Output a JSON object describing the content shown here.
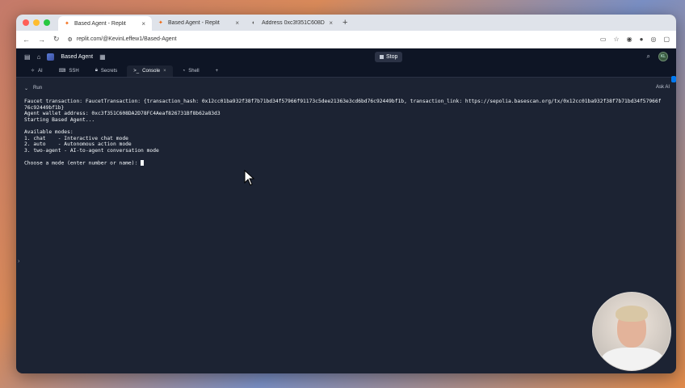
{
  "browser": {
    "tabs": [
      {
        "label": "Based Agent - Replit",
        "active": true
      },
      {
        "label": "Based Agent - Replit",
        "active": false
      },
      {
        "label": "Address 0xc3f351C608DA2…",
        "active": false
      }
    ],
    "url": "replit.com/@KevinLeffew1/Based-Agent"
  },
  "app": {
    "repl_name": "Based Agent",
    "stop_label": "Stop",
    "avatar_initials": "KL",
    "pane_tabs": [
      {
        "label": "AI",
        "icon": "ai-icon"
      },
      {
        "label": "SSH",
        "icon": "ssh-icon"
      },
      {
        "label": "Secrets",
        "icon": "lock-icon"
      },
      {
        "label": "Console",
        "icon": "terminal-icon",
        "active": true
      },
      {
        "label": "Shell",
        "icon": "shell-icon"
      }
    ],
    "run_label": "Run",
    "ask_ai_label": "Ask AI"
  },
  "console": {
    "lines": [
      "Faucet transaction: FaucetTransaction: {transaction_hash: 0x12cc01ba932f38f7b71bd34f57966f91173c5dee21363e3cd6bd76c92449bf1b, transaction_link: https://sepolia.basescan.org/tx/0x12cc01ba932f38f7b71bd34f57966f",
      "76c92449bf1b}",
      "Agent wallet address: 0xc3f351C608DA2D78FC4Aeaf826731Bf8b62a83d3",
      "Starting Based Agent...",
      "",
      "Available modes:",
      "1. chat    - Interactive chat mode",
      "2. auto    - Autonomous action mode",
      "3. two-agent - AI-to-agent conversation mode",
      "",
      "Choose a mode (enter number or name): "
    ]
  },
  "colors": {
    "accent": "#0079f2",
    "bg": "#1c2333",
    "text": "#f5f9fc"
  }
}
